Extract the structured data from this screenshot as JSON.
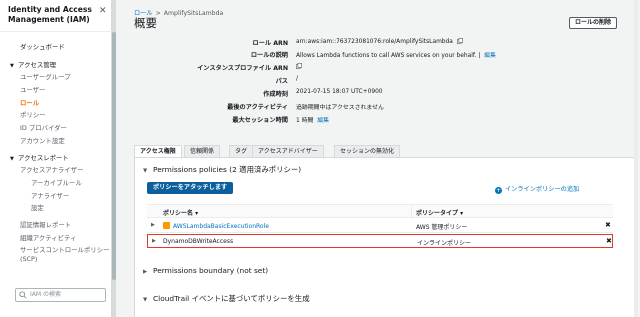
{
  "sidebar": {
    "title": "Identity and Access Management (IAM)",
    "close_glyph": "✕",
    "items": [
      {
        "label": "ダッシュボード",
        "kind": "l1b"
      },
      {
        "label": "アクセス管理",
        "kind": "head"
      },
      {
        "label": "ユーザーグループ",
        "kind": "l2"
      },
      {
        "label": "ユーザー",
        "kind": "l2"
      },
      {
        "label": "ロール",
        "kind": "active"
      },
      {
        "label": "ポリシー",
        "kind": "l2"
      },
      {
        "label": "ID プロバイダー",
        "kind": "l2"
      },
      {
        "label": "アカウント設定",
        "kind": "l2"
      },
      {
        "label": "アクセスレポート",
        "kind": "head"
      },
      {
        "label": "アクセスアナライザー",
        "kind": "l2"
      },
      {
        "label": "アーカイブルール",
        "kind": "l3"
      },
      {
        "label": "アナライザー",
        "kind": "l3"
      },
      {
        "label": "設定",
        "kind": "l3"
      },
      {
        "label": "認証情報レポート",
        "kind": "l2"
      },
      {
        "label": "組織アクティビティ",
        "kind": "l2"
      },
      {
        "label": "サービスコントロールポリシー (SCP)",
        "kind": "l2wrap"
      }
    ],
    "search_placeholder": "IAM の検索"
  },
  "breadcrumb": {
    "root": "ロール",
    "separator": ">",
    "current": "AmplifySitsLambda"
  },
  "page_title": "概要",
  "delete_button": "ロールの削除",
  "summary": {
    "arn_label": "ロール ARN",
    "arn_value": "arn:aws:iam::763723081076:role/AmplifySitsLambda",
    "desc_label": "ロールの説明",
    "desc_value": "Allows Lambda functions to call AWS services on your behalf.",
    "desc_edit": "編集",
    "profile_label": "インスタンスプロファイル ARN",
    "path_label": "パス",
    "path_value": "/",
    "created_label": "作成時刻",
    "created_value": "2021-07-15 18:07 UTC+0900",
    "last_activity_label": "最後のアクティビティ",
    "last_activity_value": "追跡期間中はアクセスされません",
    "max_session_label": "最大セッション時間",
    "max_session_value": "1 時間",
    "max_session_edit": "編集"
  },
  "tabs": [
    "アクセス権限",
    "信頼関係",
    "タグ",
    "アクセスアドバイザー",
    "セッションの無効化"
  ],
  "permissions": {
    "section_title": "Permissions policies (2 適用済みポリシー)",
    "attach_button": "ポリシーをアタッチします",
    "inline_link": "インラインポリシーの追加",
    "col_name": "ポリシー名 ▾",
    "col_type": "ポリシータイプ ▾",
    "rows": [
      {
        "name": "AWSLambdaBasicExecutionRole",
        "type": "AWS 管理ポリシー",
        "aws_managed": true
      },
      {
        "name": "DynamoDBWriteAccess",
        "type": "インラインポリシー",
        "aws_managed": false
      }
    ],
    "remove_glyph": "✖"
  },
  "boundary": {
    "section_title": "Permissions boundary (not set)"
  },
  "cloudtrail": {
    "section_title": "CloudTrail イベントに基づいてポリシーを生成"
  },
  "colors": {
    "accent": "#ec7211",
    "link": "#0073bb",
    "primary_button": "#0b5f9e",
    "highlight": "#e0382c"
  }
}
